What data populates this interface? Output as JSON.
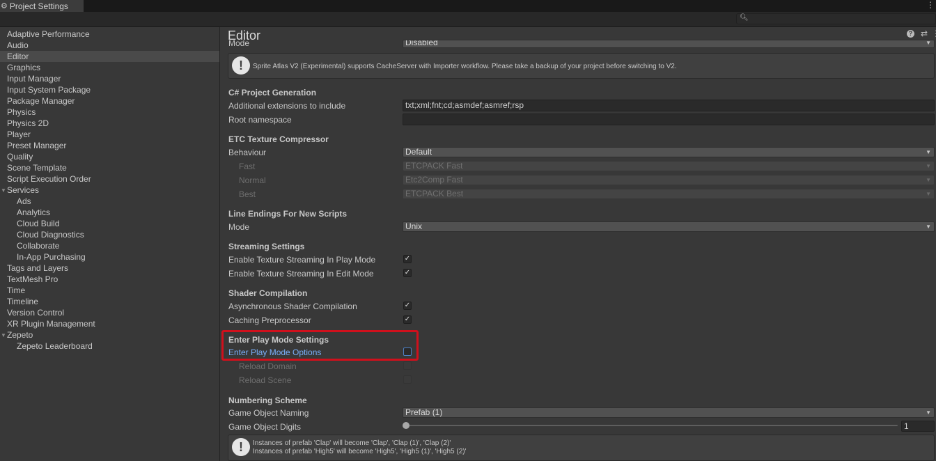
{
  "window": {
    "tab_title": "Project Settings",
    "gear_icon": "gear-icon",
    "menu_icon": "kebab-menu-icon"
  },
  "search": {
    "value": "",
    "icon": "search-icon"
  },
  "sidebar": {
    "items": [
      {
        "label": "Adaptive Performance"
      },
      {
        "label": "Audio"
      },
      {
        "label": "Editor",
        "selected": true
      },
      {
        "label": "Graphics"
      },
      {
        "label": "Input Manager"
      },
      {
        "label": "Input System Package"
      },
      {
        "label": "Package Manager"
      },
      {
        "label": "Physics"
      },
      {
        "label": "Physics 2D"
      },
      {
        "label": "Player"
      },
      {
        "label": "Preset Manager"
      },
      {
        "label": "Quality"
      },
      {
        "label": "Scene Template"
      },
      {
        "label": "Script Execution Order"
      },
      {
        "label": "Services",
        "expanded": true
      },
      {
        "label": "Ads"
      },
      {
        "label": "Analytics"
      },
      {
        "label": "Cloud Build"
      },
      {
        "label": "Cloud Diagnostics"
      },
      {
        "label": "Collaborate"
      },
      {
        "label": "In-App Purchasing"
      },
      {
        "label": "Tags and Layers"
      },
      {
        "label": "TextMesh Pro"
      },
      {
        "label": "Time"
      },
      {
        "label": "Timeline"
      },
      {
        "label": "Version Control"
      },
      {
        "label": "XR Plugin Management"
      },
      {
        "label": "Zepeto",
        "expanded": true
      },
      {
        "label": "Zepeto Leaderboard"
      }
    ]
  },
  "main": {
    "title": "Editor",
    "top": {
      "mode_label": "Mode",
      "mode_value": "Disabled"
    },
    "atlas_help": "Sprite Atlas V2 (Experimental) supports CacheServer with Importer workflow. Please take a backup of your project before switching to V2.",
    "csharp": {
      "header": "C# Project Generation",
      "extensions_label": "Additional extensions to include",
      "extensions_value": "txt;xml;fnt;cd;asmdef;asmref;rsp",
      "namespace_label": "Root namespace",
      "namespace_value": ""
    },
    "etc": {
      "header": "ETC Texture Compressor",
      "behaviour_label": "Behaviour",
      "behaviour_value": "Default",
      "fast_label": "Fast",
      "fast_value": "ETCPACK Fast",
      "normal_label": "Normal",
      "normal_value": "Etc2Comp Fast",
      "best_label": "Best",
      "best_value": "ETCPACK Best"
    },
    "line_endings": {
      "header": "Line Endings For New Scripts",
      "mode_label": "Mode",
      "mode_value": "Unix"
    },
    "streaming": {
      "header": "Streaming Settings",
      "play_label": "Enable Texture Streaming In Play Mode",
      "play_checked": true,
      "edit_label": "Enable Texture Streaming In Edit Mode",
      "edit_checked": true
    },
    "shader": {
      "header": "Shader Compilation",
      "async_label": "Asynchronous Shader Compilation",
      "async_checked": true,
      "caching_label": "Caching Preprocessor",
      "caching_checked": true
    },
    "play_mode": {
      "header": "Enter Play Mode Settings",
      "options_label": "Enter Play Mode Options",
      "options_checked": false,
      "reload_domain_label": "Reload Domain",
      "reload_scene_label": "Reload Scene"
    },
    "numbering": {
      "header": "Numbering Scheme",
      "naming_label": "Game Object Naming",
      "naming_value": "Prefab (1)",
      "digits_label": "Game Object Digits",
      "digits_value": "1",
      "help_line1": "Instances of prefab 'Clap' will become 'Clap', 'Clap (1)', 'Clap (2)'",
      "help_line2": "Instances of prefab 'High5' will become 'High5', 'High5 (1)', 'High5 (2)'"
    }
  },
  "colors": {
    "highlight_border": "#d0101c",
    "link": "#79aef7",
    "background": "#383838"
  }
}
